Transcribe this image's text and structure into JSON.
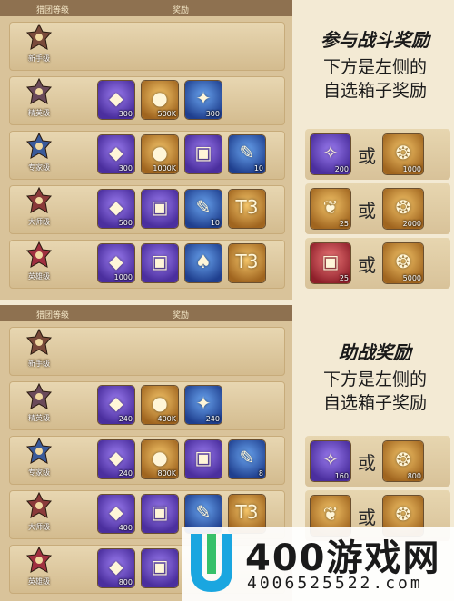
{
  "colors": {
    "panel_bg": "#d9c39a",
    "header_bg": "#8e7150",
    "accent_purple": "#6a4fd6",
    "accent_gold": "#d49a3a",
    "watermark_blue": "#1aa6e0"
  },
  "battle": {
    "header": {
      "col1": "猎团等级",
      "col2": "奖励"
    },
    "title": "参与战斗奖励",
    "subtitle_line1": "下方是左侧的",
    "subtitle_line2": "自选箱子奖励",
    "rows": [
      {
        "rank": "新手级",
        "items": []
      },
      {
        "rank": "精英级",
        "items": [
          {
            "icon": "crystal-icon",
            "qty": "300"
          },
          {
            "icon": "gold-coin-icon",
            "qty": "500K"
          },
          {
            "icon": "blue-shard-icon",
            "qty": "300"
          }
        ]
      },
      {
        "rank": "专家级",
        "items": [
          {
            "icon": "crystal-icon",
            "qty": "300"
          },
          {
            "icon": "gold-coin-icon",
            "qty": "1000K"
          },
          {
            "icon": "treasure-chest-icon",
            "qty": ""
          },
          {
            "icon": "scroll-icon",
            "qty": "10"
          }
        ]
      },
      {
        "rank": "大师级",
        "items": [
          {
            "icon": "crystal-icon",
            "qty": "500"
          },
          {
            "icon": "treasure-chest-icon",
            "qty": ""
          },
          {
            "icon": "scroll-icon",
            "qty": "10"
          },
          {
            "icon": "t3-chest-icon",
            "qty": ""
          }
        ]
      },
      {
        "rank": "英雄级",
        "items": [
          {
            "icon": "crystal-icon",
            "qty": "1000"
          },
          {
            "icon": "treasure-chest-icon",
            "qty": ""
          },
          {
            "icon": "card-icon",
            "qty": ""
          },
          {
            "icon": "t3-chest-icon",
            "qty": ""
          }
        ]
      }
    ],
    "choices": [
      {
        "left": {
          "icon": "shard-gift-icon",
          "qty": "200"
        },
        "or": "或",
        "right": {
          "icon": "medal-icon",
          "qty": "1000"
        }
      },
      {
        "left": {
          "icon": "feather-icon",
          "qty": "25"
        },
        "or": "或",
        "right": {
          "icon": "medal-icon",
          "qty": "2000"
        }
      },
      {
        "left": {
          "icon": "red-chest-icon",
          "qty": "25"
        },
        "or": "或",
        "right": {
          "icon": "medal-icon",
          "qty": "5000"
        }
      }
    ]
  },
  "assist": {
    "header": {
      "col1": "猎团等级",
      "col2": "奖励"
    },
    "title": "助战奖励",
    "subtitle_line1": "下方是左侧的",
    "subtitle_line2": "自选箱子奖励",
    "rows": [
      {
        "rank": "新手级",
        "items": []
      },
      {
        "rank": "精英级",
        "items": [
          {
            "icon": "crystal-icon",
            "qty": "240"
          },
          {
            "icon": "gold-coin-icon",
            "qty": "400K"
          },
          {
            "icon": "blue-shard-icon",
            "qty": "240"
          }
        ]
      },
      {
        "rank": "专家级",
        "items": [
          {
            "icon": "crystal-icon",
            "qty": "240"
          },
          {
            "icon": "gold-coin-icon",
            "qty": "800K"
          },
          {
            "icon": "treasure-chest-icon",
            "qty": ""
          },
          {
            "icon": "scroll-icon",
            "qty": "8"
          }
        ]
      },
      {
        "rank": "大师级",
        "items": [
          {
            "icon": "crystal-icon",
            "qty": "400"
          },
          {
            "icon": "treasure-chest-icon",
            "qty": ""
          },
          {
            "icon": "scroll-icon",
            "qty": ""
          },
          {
            "icon": "t3-chest-icon",
            "qty": ""
          }
        ]
      },
      {
        "rank": "英雄级",
        "items": [
          {
            "icon": "crystal-icon",
            "qty": "800"
          },
          {
            "icon": "treasure-chest-icon",
            "qty": ""
          }
        ]
      }
    ],
    "choices": [
      {
        "left": {
          "icon": "shard-gift-icon",
          "qty": "160"
        },
        "or": "或",
        "right": {
          "icon": "medal-icon",
          "qty": "800"
        }
      },
      {
        "left": {
          "icon": "feather-icon",
          "qty": ""
        },
        "or": "或",
        "right": {
          "icon": "medal-icon",
          "qty": ""
        }
      }
    ]
  },
  "watermark": {
    "brand": "400游戏网",
    "phone": "4006525522.com"
  }
}
